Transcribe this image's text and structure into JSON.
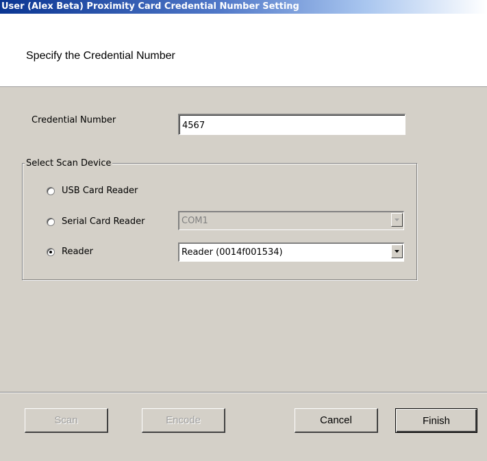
{
  "window": {
    "title": "User (Alex Beta) Proximity Card Credential Number Setting"
  },
  "header": {
    "text": "Specify the Credential Number"
  },
  "credential": {
    "label": "Credential Number",
    "value": "4567"
  },
  "scan_device": {
    "legend": "Select Scan Device",
    "options": [
      {
        "label": "USB Card Reader",
        "checked": false
      },
      {
        "label": "Serial Card Reader",
        "checked": false,
        "combo_value": "COM1",
        "combo_disabled": true
      },
      {
        "label": "Reader",
        "checked": true,
        "combo_value": "Reader (0014f001534)",
        "combo_disabled": false
      }
    ]
  },
  "buttons": {
    "scan": "Scan",
    "encode": "Encode",
    "cancel": "Cancel",
    "finish": "Finish"
  },
  "colors": {
    "dialog_bg": "#d4d0c8",
    "titlebar_start": "#0a3592",
    "disabled_text": "#a0a0a0"
  }
}
